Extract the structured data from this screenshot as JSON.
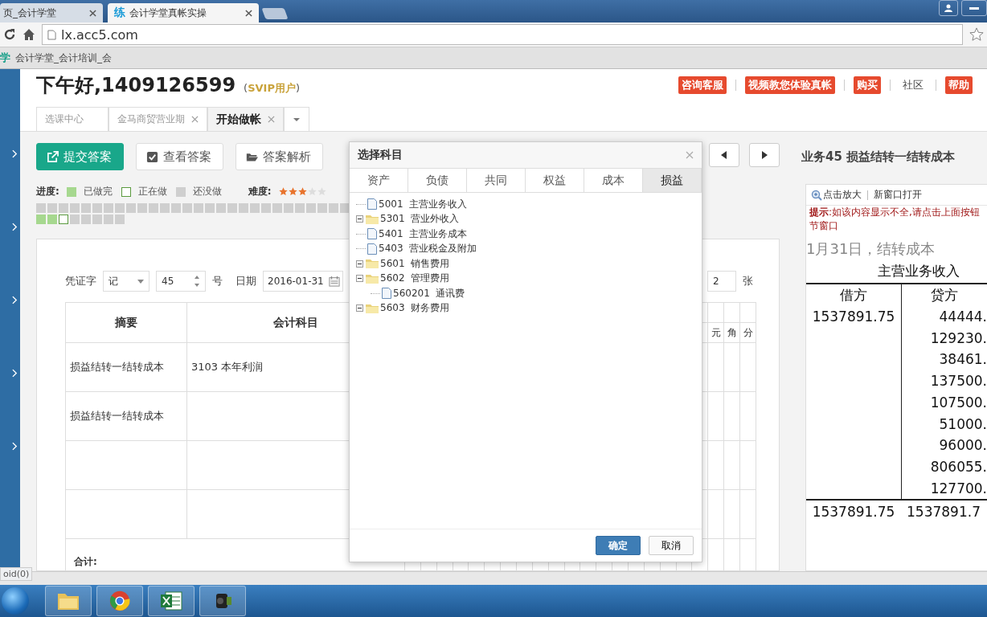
{
  "browser": {
    "tabs": [
      {
        "title": "页_会计学堂",
        "selected": false
      },
      {
        "badge": "练",
        "title": "会计学堂真帐实操",
        "selected": true
      }
    ],
    "url": "lx.acc5.com",
    "bookmarks": [
      {
        "logo": "学",
        "title": "会计学堂_会计培训_会"
      }
    ]
  },
  "header": {
    "greeting": "下午好,1409126599",
    "membership": "(**SVIP用户**)",
    "links": [
      {
        "label": "咨询客服",
        "kind": "badge"
      },
      {
        "label": "视频教您体验真帐",
        "kind": "badge"
      },
      {
        "label": "购买",
        "kind": "badge"
      },
      {
        "label": "社区",
        "kind": "plain"
      },
      {
        "label": "帮助",
        "kind": "badge"
      }
    ]
  },
  "page_tabs": [
    {
      "label": "选课中心",
      "closable": false,
      "selected": false
    },
    {
      "label": "金马商贸营业期",
      "closable": true,
      "selected": false
    },
    {
      "label": "开始做帐",
      "closable": true,
      "selected": true
    }
  ],
  "toolbar": [
    {
      "label": "提交答案",
      "kind": "primary"
    },
    {
      "label": "查看答案",
      "kind": "check"
    },
    {
      "label": "答案解析",
      "kind": "folder"
    }
  ],
  "task_title": "业务45  损益结转一结转成本",
  "progress": {
    "label": "进度:",
    "legend": [
      {
        "done": true,
        "current": false,
        "label": "已做完"
      },
      {
        "done": false,
        "current": true,
        "label": "正在做"
      },
      {
        "done": false,
        "current": false,
        "label": "还没做"
      }
    ],
    "difficulty_label": "难度:",
    "stars": 3,
    "squares": [
      {
        "done": false,
        "current": false
      },
      {
        "done": false,
        "current": false
      },
      {
        "done": false,
        "current": false
      },
      {
        "done": false,
        "current": false
      },
      {
        "done": false,
        "current": false
      },
      {
        "done": false,
        "current": false
      },
      {
        "done": false,
        "current": false
      },
      {
        "done": false,
        "current": false
      },
      {
        "done": false,
        "current": false
      },
      {
        "done": false,
        "current": false
      },
      {
        "done": false,
        "current": false
      },
      {
        "done": false,
        "current": false
      },
      {
        "done": false,
        "current": false
      },
      {
        "done": false,
        "current": false
      },
      {
        "done": false,
        "current": false
      },
      {
        "done": false,
        "current": false
      },
      {
        "done": false,
        "current": false
      },
      {
        "done": false,
        "current": false
      },
      {
        "done": false,
        "current": false
      },
      {
        "done": false,
        "current": false
      },
      {
        "done": false,
        "current": false
      },
      {
        "done": false,
        "current": false
      },
      {
        "done": false,
        "current": false
      },
      {
        "done": false,
        "current": false
      },
      {
        "done": false,
        "current": false
      },
      {
        "done": false,
        "current": false
      },
      {
        "done": false,
        "current": false
      },
      {
        "done": false,
        "current": false
      },
      {
        "done": true,
        "current": false
      },
      {
        "done": true,
        "current": false
      },
      {
        "done": false,
        "current": true
      },
      {
        "done": false,
        "current": false
      },
      {
        "done": false,
        "current": false
      },
      {
        "done": false,
        "current": false
      },
      {
        "done": false,
        "current": false
      },
      {
        "done": false,
        "current": false
      }
    ]
  },
  "voucher": {
    "type_label": "凭证字",
    "type_value": "记",
    "number": "45",
    "number_suffix": "号",
    "date_label": "日期",
    "date": "2016-01-31",
    "attach_count": "2",
    "attach_suffix": "张",
    "columns": {
      "summary": "摘要",
      "subject": "会计科目",
      "digits_visible": [
        "元",
        "角",
        "分"
      ]
    },
    "rows": [
      {
        "summary": "损益结转一结转成本",
        "subject": "3103  本年利润"
      },
      {
        "summary": "损益结转一结转成本",
        "subject": ""
      },
      {
        "summary": "",
        "subject": ""
      },
      {
        "summary": "",
        "subject": ""
      }
    ],
    "total_label": "合计:"
  },
  "reference": {
    "zoom_label": "点击放大",
    "open_label": "新窗口打开",
    "hint": [
      "**提示**:如该内容显示不全,请点击上面按钮",
      "节窗口"
    ],
    "heading": "1月31日，结转成本",
    "account": "主营业务收入",
    "debit_header": "借方",
    "credit_header": "贷方",
    "debits": [
      "1537891.75"
    ],
    "credits": [
      "44444.",
      "129230.",
      "38461.",
      "137500.",
      "107500.",
      "51000.",
      "96000.",
      "806055.",
      "127700."
    ],
    "debit_total": "1537891.75",
    "credit_total": "1537891.7"
  },
  "dialog": {
    "title": "选择科目",
    "tabs": [
      {
        "label": "资产",
        "selected": false
      },
      {
        "label": "负债",
        "selected": false
      },
      {
        "label": "共同",
        "selected": false
      },
      {
        "label": "权益",
        "selected": false
      },
      {
        "label": "成本",
        "selected": false
      },
      {
        "label": "损益",
        "selected": true
      }
    ],
    "tree": [
      {
        "kind": "file",
        "code": "5001",
        "name": "主营业务收入"
      },
      {
        "kind": "folder",
        "code": "5301",
        "name": "营业外收入",
        "expanded": true
      },
      {
        "kind": "file",
        "code": "5401",
        "name": "主营业务成本"
      },
      {
        "kind": "file",
        "code": "5403",
        "name": "营业税金及附加"
      },
      {
        "kind": "folder",
        "code": "5601",
        "name": "销售费用",
        "expanded": true
      },
      {
        "kind": "folder",
        "code": "5602",
        "name": "管理费用",
        "expanded": true,
        "children": [
          {
            "kind": "file",
            "code": "560201",
            "name": "通讯费"
          }
        ]
      },
      {
        "kind": "folder",
        "code": "5603",
        "name": "财务费用",
        "expanded": true
      }
    ],
    "buttons": [
      {
        "label": "确定",
        "kind": "primary"
      },
      {
        "label": "取消",
        "kind": "secondary"
      }
    ]
  },
  "status_text": "oid(0)"
}
